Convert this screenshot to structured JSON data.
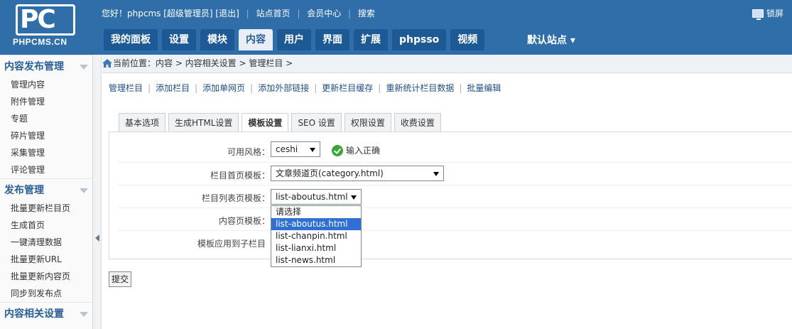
{
  "header": {
    "logo_letters": "PC",
    "logo_text": "PHPCMS.CN",
    "greeting": "您好！phpcms [超级管理员]",
    "logout": "[退出]",
    "site_home": "站点首页",
    "member_center": "会员中心",
    "search": "搜索",
    "lock_screen": "锁屏",
    "nav_tabs": [
      "我的面板",
      "设置",
      "模块",
      "内容",
      "用户",
      "界面",
      "扩展",
      "phpsso",
      "视频"
    ],
    "active_tab": "内容",
    "default_site": "默认站点"
  },
  "sidebar": {
    "sections": [
      {
        "title": "内容发布管理",
        "items": [
          "管理内容",
          "附件管理",
          "专题",
          "碎片管理",
          "采集管理",
          "评论管理"
        ]
      },
      {
        "title": "发布管理",
        "items": [
          "批量更新栏目页",
          "生成首页",
          "一键清理数据",
          "批量更新URL",
          "批量更新内容页",
          "同步到发布点"
        ]
      },
      {
        "title": "内容相关设置",
        "items": []
      }
    ]
  },
  "breadcrumb": {
    "text": "当前位置：内容 > 内容相关设置 > 管理栏目 >"
  },
  "subnav": [
    "管理栏目",
    "添加栏目",
    "添加单网页",
    "添加外部链接",
    "更新栏目缓存",
    "重新统计栏目数据",
    "批量编辑"
  ],
  "form_tabs": [
    "基本选项",
    "生成HTML设置",
    "模板设置",
    "SEO 设置",
    "权限设置",
    "收费设置"
  ],
  "active_form_tab": "模板设置",
  "fields": {
    "style_label": "可用风格：",
    "style_value": "ceshi",
    "style_ok": "输入正确",
    "category_tpl_label": "栏目首页模板：",
    "category_tpl_value": "文章频道页(category.html)",
    "list_tpl_label": "栏目列表页模板：",
    "list_tpl_value": "list-aboutus.html",
    "content_tpl_label": "内容页模板：",
    "apply_children_label": "模板应用到子栏目"
  },
  "dropdown_options": [
    "请选择",
    "list-aboutus.html",
    "list-chanpin.html",
    "list-lianxi.html",
    "list-news.html"
  ],
  "dropdown_highlighted": "list-aboutus.html",
  "submit_label": "提交",
  "colors": {
    "header_bg": "#2f6ea8",
    "nav_tab_bg": "#1d5a95",
    "highlight": "#3070d5",
    "link": "#1f4e86"
  }
}
